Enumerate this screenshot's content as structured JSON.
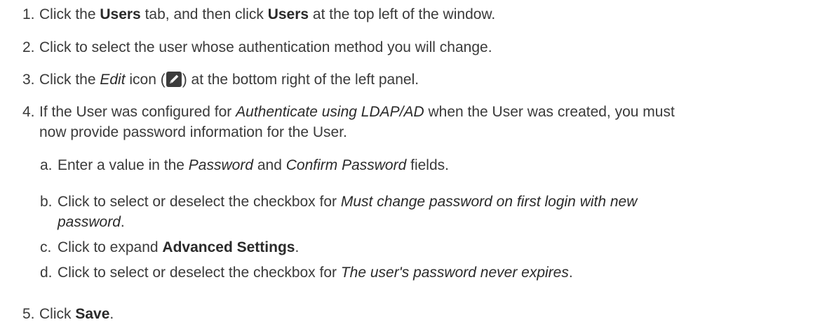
{
  "steps": [
    {
      "num": "1.",
      "t1": "Click the ",
      "b1": "Users",
      "t2": " tab, and then click ",
      "b2": "Users",
      "t3": " at the top left of the window."
    },
    {
      "num": "2.",
      "t1": "Click to select the user whose authentication method you will change."
    },
    {
      "num": "3.",
      "t1": "Click the ",
      "i1": "Edit",
      "t2": " icon (",
      "t3": ") at the bottom right of the left panel.",
      "icon": "pencil-edit-icon"
    },
    {
      "num": "4.",
      "t1": "If the User was configured for ",
      "i1": "Authenticate using LDAP/AD",
      "t2": " when the User was created, you must",
      "line2": "now provide password information for the User.",
      "substeps": [
        {
          "num": "a.",
          "t1": "Enter a value in the ",
          "i1": "Password",
          "t2": " and ",
          "i2": "Confirm Password",
          "t3": " fields."
        },
        {
          "num": "b.",
          "t1": "Click to select or deselect the checkbox for ",
          "i1": "Must change password on first login with new",
          "i1b": "password",
          "t2": "."
        },
        {
          "num": "c.",
          "t1": "Click to expand ",
          "b1": "Advanced Settings",
          "t2": "."
        },
        {
          "num": "d.",
          "t1": "Click to select or deselect the checkbox for ",
          "i1": "The user's password never expires",
          "t2": "."
        }
      ]
    },
    {
      "num": "5.",
      "t1": "Click ",
      "b1": "Save",
      "t2": "."
    }
  ]
}
